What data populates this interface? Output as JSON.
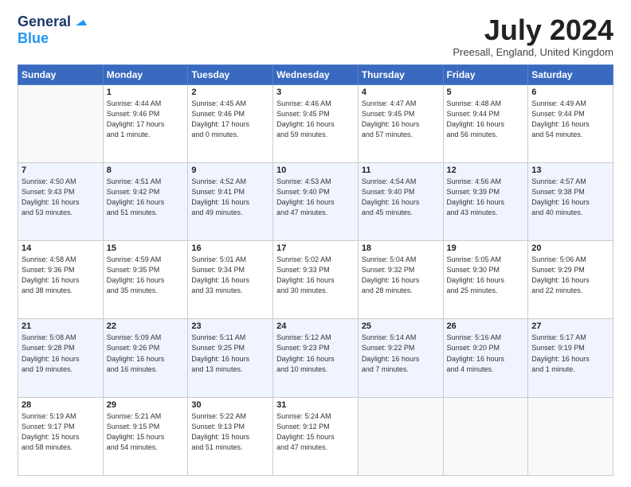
{
  "header": {
    "logo_line1": "General",
    "logo_line2": "Blue",
    "month_title": "July 2024",
    "location": "Preesall, England, United Kingdom"
  },
  "weekdays": [
    "Sunday",
    "Monday",
    "Tuesday",
    "Wednesday",
    "Thursday",
    "Friday",
    "Saturday"
  ],
  "weeks": [
    [
      {
        "day": "",
        "info": ""
      },
      {
        "day": "1",
        "info": "Sunrise: 4:44 AM\nSunset: 9:46 PM\nDaylight: 17 hours\nand 1 minute."
      },
      {
        "day": "2",
        "info": "Sunrise: 4:45 AM\nSunset: 9:46 PM\nDaylight: 17 hours\nand 0 minutes."
      },
      {
        "day": "3",
        "info": "Sunrise: 4:46 AM\nSunset: 9:45 PM\nDaylight: 16 hours\nand 59 minutes."
      },
      {
        "day": "4",
        "info": "Sunrise: 4:47 AM\nSunset: 9:45 PM\nDaylight: 16 hours\nand 57 minutes."
      },
      {
        "day": "5",
        "info": "Sunrise: 4:48 AM\nSunset: 9:44 PM\nDaylight: 16 hours\nand 56 minutes."
      },
      {
        "day": "6",
        "info": "Sunrise: 4:49 AM\nSunset: 9:44 PM\nDaylight: 16 hours\nand 54 minutes."
      }
    ],
    [
      {
        "day": "7",
        "info": "Sunrise: 4:50 AM\nSunset: 9:43 PM\nDaylight: 16 hours\nand 53 minutes."
      },
      {
        "day": "8",
        "info": "Sunrise: 4:51 AM\nSunset: 9:42 PM\nDaylight: 16 hours\nand 51 minutes."
      },
      {
        "day": "9",
        "info": "Sunrise: 4:52 AM\nSunset: 9:41 PM\nDaylight: 16 hours\nand 49 minutes."
      },
      {
        "day": "10",
        "info": "Sunrise: 4:53 AM\nSunset: 9:40 PM\nDaylight: 16 hours\nand 47 minutes."
      },
      {
        "day": "11",
        "info": "Sunrise: 4:54 AM\nSunset: 9:40 PM\nDaylight: 16 hours\nand 45 minutes."
      },
      {
        "day": "12",
        "info": "Sunrise: 4:56 AM\nSunset: 9:39 PM\nDaylight: 16 hours\nand 43 minutes."
      },
      {
        "day": "13",
        "info": "Sunrise: 4:57 AM\nSunset: 9:38 PM\nDaylight: 16 hours\nand 40 minutes."
      }
    ],
    [
      {
        "day": "14",
        "info": "Sunrise: 4:58 AM\nSunset: 9:36 PM\nDaylight: 16 hours\nand 38 minutes."
      },
      {
        "day": "15",
        "info": "Sunrise: 4:59 AM\nSunset: 9:35 PM\nDaylight: 16 hours\nand 35 minutes."
      },
      {
        "day": "16",
        "info": "Sunrise: 5:01 AM\nSunset: 9:34 PM\nDaylight: 16 hours\nand 33 minutes."
      },
      {
        "day": "17",
        "info": "Sunrise: 5:02 AM\nSunset: 9:33 PM\nDaylight: 16 hours\nand 30 minutes."
      },
      {
        "day": "18",
        "info": "Sunrise: 5:04 AM\nSunset: 9:32 PM\nDaylight: 16 hours\nand 28 minutes."
      },
      {
        "day": "19",
        "info": "Sunrise: 5:05 AM\nSunset: 9:30 PM\nDaylight: 16 hours\nand 25 minutes."
      },
      {
        "day": "20",
        "info": "Sunrise: 5:06 AM\nSunset: 9:29 PM\nDaylight: 16 hours\nand 22 minutes."
      }
    ],
    [
      {
        "day": "21",
        "info": "Sunrise: 5:08 AM\nSunset: 9:28 PM\nDaylight: 16 hours\nand 19 minutes."
      },
      {
        "day": "22",
        "info": "Sunrise: 5:09 AM\nSunset: 9:26 PM\nDaylight: 16 hours\nand 16 minutes."
      },
      {
        "day": "23",
        "info": "Sunrise: 5:11 AM\nSunset: 9:25 PM\nDaylight: 16 hours\nand 13 minutes."
      },
      {
        "day": "24",
        "info": "Sunrise: 5:12 AM\nSunset: 9:23 PM\nDaylight: 16 hours\nand 10 minutes."
      },
      {
        "day": "25",
        "info": "Sunrise: 5:14 AM\nSunset: 9:22 PM\nDaylight: 16 hours\nand 7 minutes."
      },
      {
        "day": "26",
        "info": "Sunrise: 5:16 AM\nSunset: 9:20 PM\nDaylight: 16 hours\nand 4 minutes."
      },
      {
        "day": "27",
        "info": "Sunrise: 5:17 AM\nSunset: 9:19 PM\nDaylight: 16 hours\nand 1 minute."
      }
    ],
    [
      {
        "day": "28",
        "info": "Sunrise: 5:19 AM\nSunset: 9:17 PM\nDaylight: 15 hours\nand 58 minutes."
      },
      {
        "day": "29",
        "info": "Sunrise: 5:21 AM\nSunset: 9:15 PM\nDaylight: 15 hours\nand 54 minutes."
      },
      {
        "day": "30",
        "info": "Sunrise: 5:22 AM\nSunset: 9:13 PM\nDaylight: 15 hours\nand 51 minutes."
      },
      {
        "day": "31",
        "info": "Sunrise: 5:24 AM\nSunset: 9:12 PM\nDaylight: 15 hours\nand 47 minutes."
      },
      {
        "day": "",
        "info": ""
      },
      {
        "day": "",
        "info": ""
      },
      {
        "day": "",
        "info": ""
      }
    ]
  ]
}
